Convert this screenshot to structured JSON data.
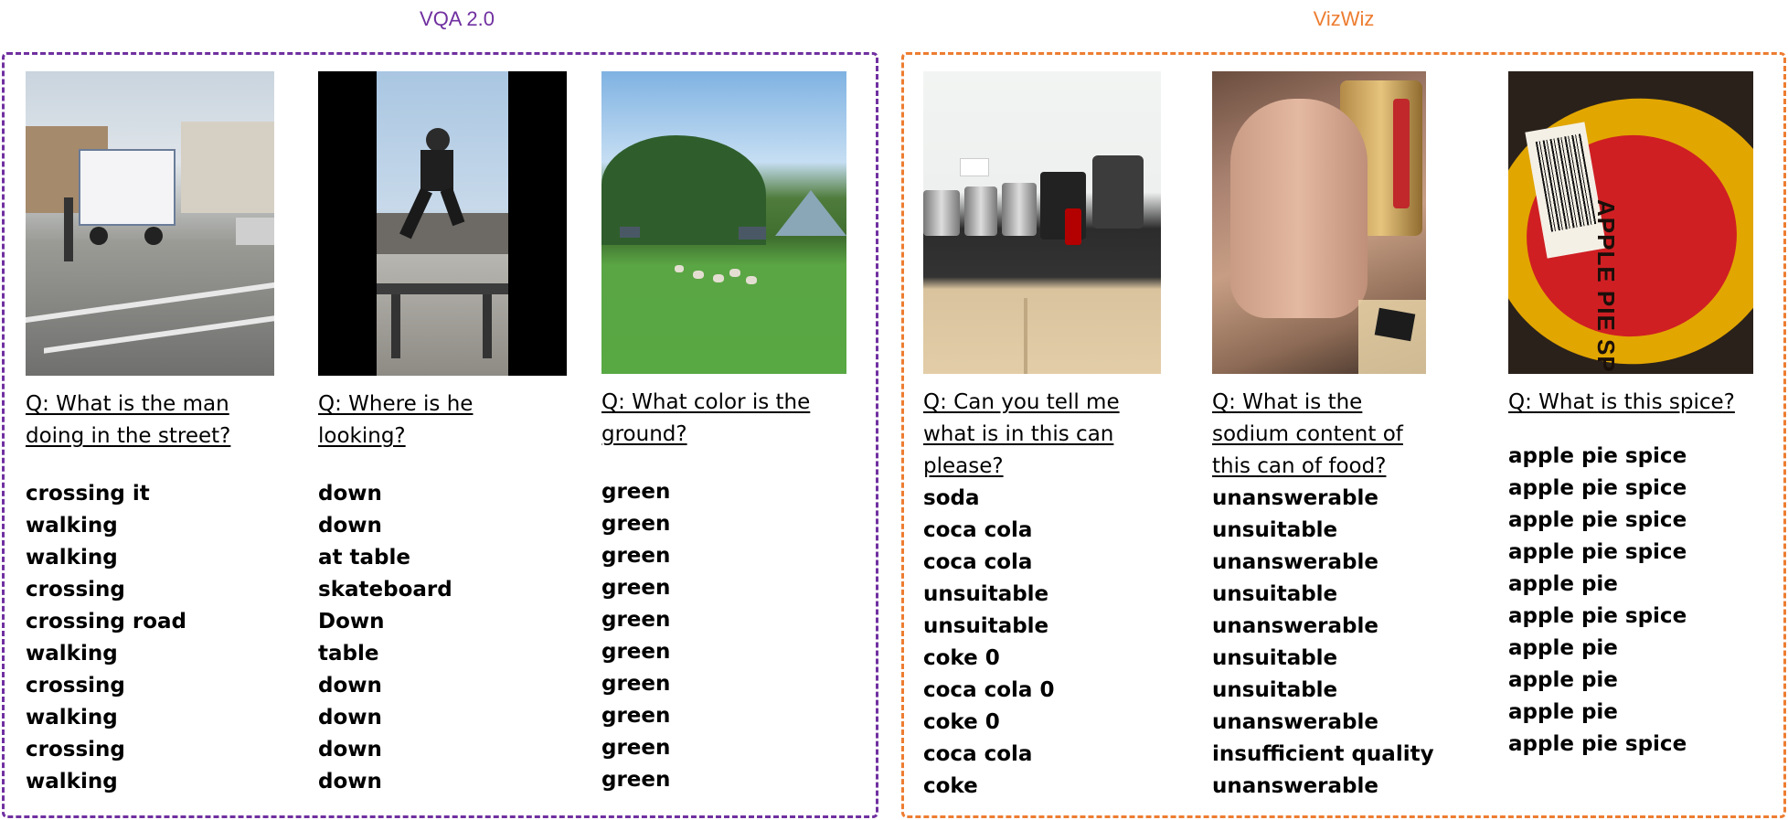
{
  "groups": [
    {
      "title": "VQA 2.0",
      "color": "#7030A0"
    },
    {
      "title": "VizWiz",
      "color": "#ED7D31"
    }
  ],
  "panels": [
    {
      "photo": "street-scene-ice-cream-truck",
      "question": "Q: What is the man doing in the street?",
      "answers": [
        "crossing it",
        "walking",
        "walking",
        "crossing",
        "crossing road",
        "walking",
        "crossing",
        "walking",
        "crossing",
        "walking"
      ]
    },
    {
      "photo": "skateboarder-jumping-over-table",
      "question": "Q: Where is he looking?",
      "answers": [
        "down",
        "down",
        "at table",
        "skateboard",
        "Down",
        "table",
        "down",
        "down",
        "down",
        "down"
      ]
    },
    {
      "photo": "sheep-grazing-green-field",
      "question": "Q: What color is the ground?",
      "answers": [
        "green",
        "green",
        "green",
        "green",
        "green",
        "green",
        "green",
        "green",
        "green",
        "green"
      ]
    },
    {
      "photo": "kitchen-counter-with-can",
      "question": "Q: Can you tell me what is in this can please?",
      "answers": [
        "soda",
        "coca cola",
        "coca cola",
        "unsuitable",
        "unsuitable",
        "coke 0",
        "coca cola 0",
        "coke 0",
        "coca cola",
        "coke"
      ]
    },
    {
      "photo": "thumb-over-can-blurry",
      "question": "Q: What is the sodium content of this can of food?",
      "answers": [
        "unanswerable",
        "unsuitable",
        "unanswerable",
        "unsuitable",
        "unanswerable",
        "unsuitable",
        "unsuitable",
        "unanswerable",
        "insufficient quality",
        "unanswerable"
      ]
    },
    {
      "photo": "apple-pie-spice-label",
      "question": "Q: What is this spice?",
      "answers": [
        "apple pie spice",
        "apple pie spice",
        "apple pie spice",
        "apple pie spice",
        "apple pie",
        "apple pie spice",
        "apple pie",
        "apple pie",
        "apple pie",
        "apple pie spice"
      ],
      "label_text": "APPLE PIE SPICE"
    }
  ]
}
